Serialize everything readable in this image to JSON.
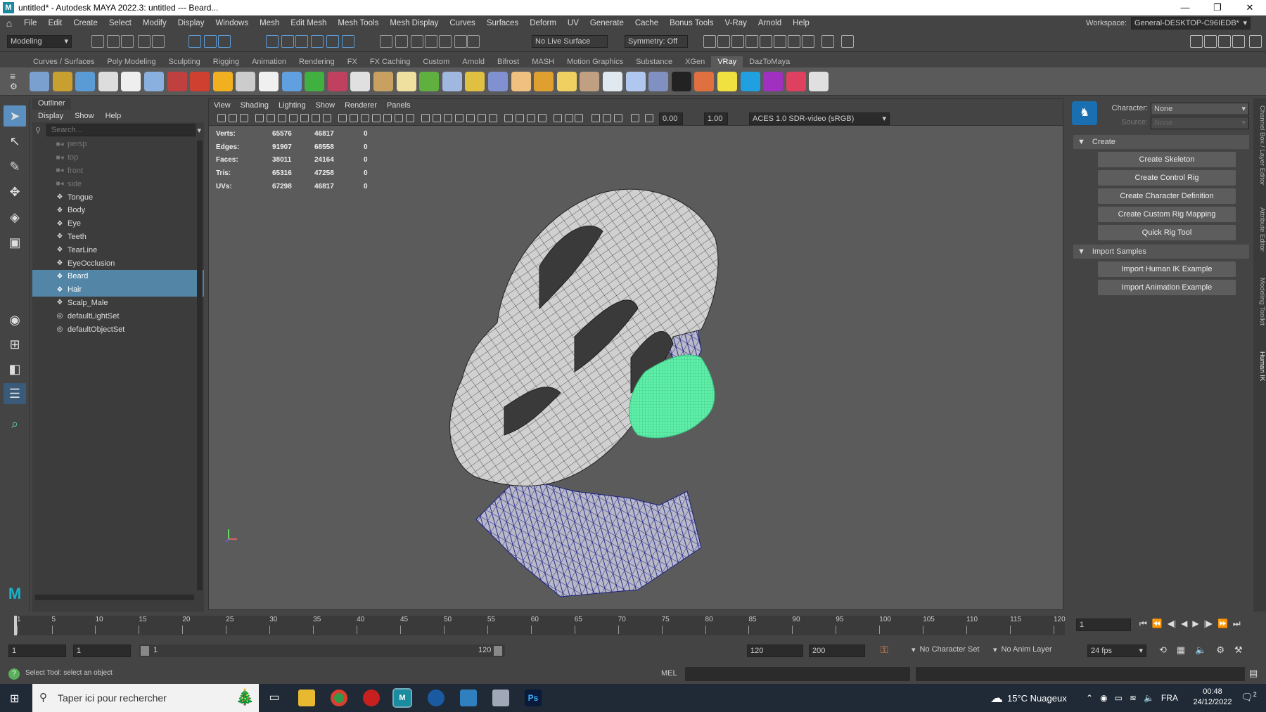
{
  "window": {
    "title": "untitled* - Autodesk MAYA 2022.3: untitled   ---   Beard...",
    "controls": [
      "—",
      "❐",
      "✕"
    ]
  },
  "menubar": {
    "items": [
      "File",
      "Edit",
      "Create",
      "Select",
      "Modify",
      "Display",
      "Windows",
      "Mesh",
      "Edit Mesh",
      "Mesh Tools",
      "Mesh Display",
      "Curves",
      "Surfaces",
      "Deform",
      "UV",
      "Generate",
      "Cache",
      "Bonus Tools",
      "V-Ray",
      "Arnold",
      "Help"
    ],
    "workspace_label": "Workspace:",
    "workspace_value": "General-DESKTOP-C96IEDB*"
  },
  "statusline": {
    "mode": "Modeling",
    "live_surface": "No Live Surface",
    "symmetry": "Symmetry: Off"
  },
  "shelf": {
    "tabs": [
      "Curves / Surfaces",
      "Poly Modeling",
      "Sculpting",
      "Rigging",
      "Animation",
      "Rendering",
      "FX",
      "FX Caching",
      "Custom",
      "Arnold",
      "Bifrost",
      "MASH",
      "Motion Graphics",
      "Substance",
      "XGen",
      "VRay",
      "DazToMaya"
    ],
    "active_tab": "VRay"
  },
  "outliner": {
    "tab": "Outliner",
    "menu": [
      "Display",
      "Show",
      "Help"
    ],
    "search_placeholder": "Search...",
    "items": [
      {
        "label": "persp",
        "icon": "camera-icon",
        "dim": true,
        "selected": false
      },
      {
        "label": "top",
        "icon": "camera-icon",
        "dim": true,
        "selected": false
      },
      {
        "label": "front",
        "icon": "camera-icon",
        "dim": true,
        "selected": false
      },
      {
        "label": "side",
        "icon": "camera-icon",
        "dim": true,
        "selected": false
      },
      {
        "label": "Tongue",
        "icon": "mesh-icon",
        "dim": false,
        "selected": false
      },
      {
        "label": "Body",
        "icon": "mesh-icon",
        "dim": false,
        "selected": false
      },
      {
        "label": "Eye",
        "icon": "mesh-icon",
        "dim": false,
        "selected": false
      },
      {
        "label": "Teeth",
        "icon": "mesh-icon",
        "dim": false,
        "selected": false
      },
      {
        "label": "TearLine",
        "icon": "mesh-icon",
        "dim": false,
        "selected": false
      },
      {
        "label": "EyeOcclusion",
        "icon": "mesh-icon",
        "dim": false,
        "selected": false
      },
      {
        "label": "Beard",
        "icon": "mesh-icon",
        "dim": false,
        "selected": true
      },
      {
        "label": "Hair",
        "icon": "mesh-icon",
        "dim": false,
        "selected": true
      },
      {
        "label": "Scalp_Male",
        "icon": "mesh-icon",
        "dim": false,
        "selected": false
      },
      {
        "label": "defaultLightSet",
        "icon": "set-icon",
        "dim": false,
        "selected": false
      },
      {
        "label": "defaultObjectSet",
        "icon": "set-icon",
        "dim": false,
        "selected": false
      }
    ]
  },
  "viewport": {
    "menu": [
      "View",
      "Shading",
      "Lighting",
      "Show",
      "Renderer",
      "Panels"
    ],
    "exposure": "0.00",
    "gamma": "1.00",
    "color_space": "ACES 1.0 SDR-video (sRGB)",
    "hud": [
      {
        "label": "Verts:",
        "a": "65576",
        "b": "46817",
        "c": "0"
      },
      {
        "label": "Edges:",
        "a": "91907",
        "b": "68558",
        "c": "0"
      },
      {
        "label": "Faces:",
        "a": "38011",
        "b": "24164",
        "c": "0"
      },
      {
        "label": "Tris:",
        "a": "65316",
        "b": "47258",
        "c": "0"
      },
      {
        "label": "UVs:",
        "a": "67298",
        "b": "46817",
        "c": "0"
      }
    ]
  },
  "hik": {
    "character_label": "Character:",
    "character_value": "None",
    "source_label": "Source:",
    "source_value": "None",
    "create_section": "Create",
    "create_buttons": [
      "Create Skeleton",
      "Create Control Rig",
      "Create Character Definition",
      "Create Custom Rig Mapping",
      "Quick Rig Tool"
    ],
    "import_section": "Import Samples",
    "import_buttons": [
      "Import Human IK Example",
      "Import Animation Example"
    ]
  },
  "side_tabs": [
    "Channel Box / Layer Editor",
    "Attribute Editor",
    "Modeling Toolkit",
    "Human IK"
  ],
  "timeline": {
    "ticks": [
      "1",
      "5",
      "10",
      "15",
      "20",
      "25",
      "30",
      "35",
      "40",
      "45",
      "50",
      "55",
      "60",
      "65",
      "70",
      "75",
      "80",
      "85",
      "90",
      "95",
      "100",
      "105",
      "110",
      "115",
      "120"
    ],
    "current_frame": "1"
  },
  "range": {
    "start": "1",
    "playback_start": "1",
    "range_min": "1",
    "range_max": "120",
    "playback_end": "120",
    "end": "200",
    "character_set": "No Character Set",
    "anim_layer": "No Anim Layer",
    "fps": "24 fps"
  },
  "cmdline": {
    "help_text": "Select Tool: select an object",
    "lang": "MEL"
  },
  "taskbar": {
    "search_placeholder": "Taper ici pour rechercher",
    "weather": "15°C  Nuageux",
    "lang": "FRA",
    "time": "00:48",
    "date": "24/12/2022",
    "notif_count": "2"
  },
  "colors": {
    "selection": "#5285a6",
    "beard_wire": "#5ef0a8",
    "body_wire": "#1a2080"
  }
}
